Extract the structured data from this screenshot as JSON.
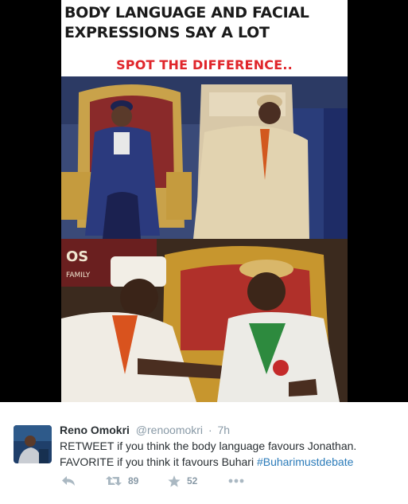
{
  "image": {
    "headline_line1": "BODY LANGUAGE AND FACIAL",
    "headline_line2": "EXPRESSIONS SAY A LOT",
    "subhead": "SPOT THE DIFFERENCE..",
    "banner_text": "OS",
    "banner_text_2": "FAMILY"
  },
  "tweet": {
    "user_name": "Reno Omokri",
    "handle": "@renoomokri",
    "separator": "·",
    "timestamp": "7h",
    "text_line1": "RETWEET if you think the body language favours Jonathan.",
    "text_line2_prefix": "FAVORITE if you think it favours Buhari ",
    "hashtag": "#Buharimustdebate"
  },
  "actions": {
    "reply_icon": "reply-icon",
    "retweet_icon": "retweet-icon",
    "retweet_count": "89",
    "favorite_icon": "star-icon",
    "favorite_count": "52",
    "more_icon": "more-dots-icon"
  },
  "colors": {
    "headline": "#1a1a1a",
    "subhead": "#e0262b",
    "text": "#292f33",
    "muted": "#8899a6",
    "hashtag": "#2b7bb9",
    "action_icon": "#aab8c2"
  }
}
